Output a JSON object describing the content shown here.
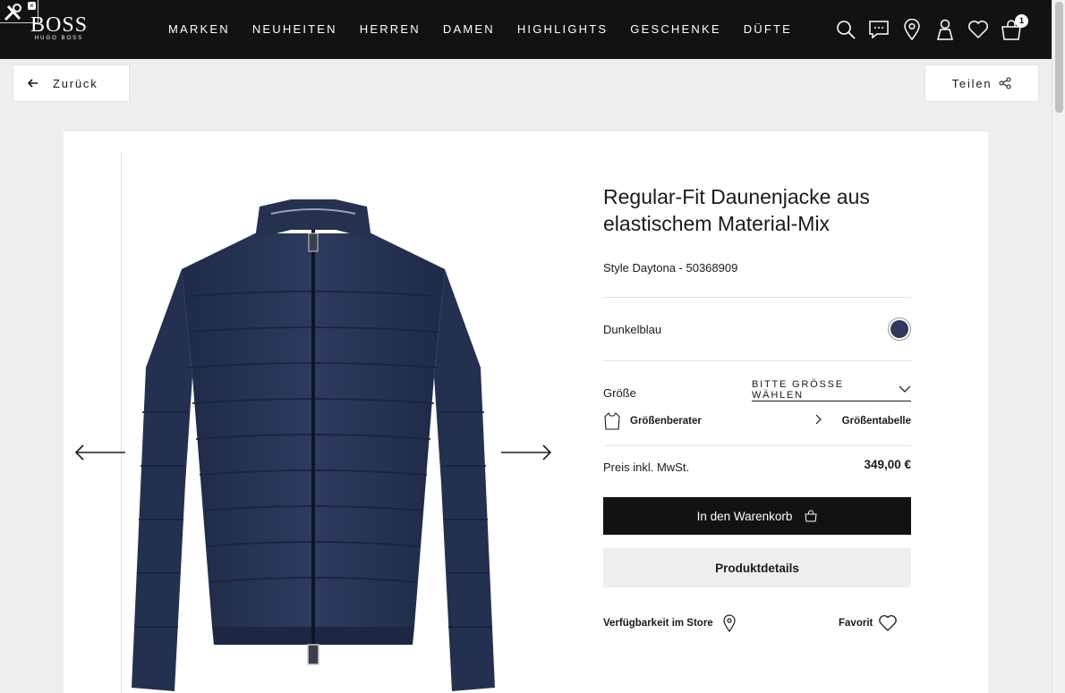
{
  "header": {
    "logo_main": "BOSS",
    "logo_sub": "HUGO BOSS",
    "nav": [
      {
        "label": "MARKEN"
      },
      {
        "label": "NEUHEITEN"
      },
      {
        "label": "HERREN"
      },
      {
        "label": "DAMEN"
      },
      {
        "label": "HIGHLIGHTS"
      },
      {
        "label": "GESCHENKE"
      },
      {
        "label": "DÜFTE"
      }
    ],
    "icons": [
      "search-icon",
      "chat-icon",
      "location-pin-icon",
      "account-icon",
      "wishlist-heart-icon",
      "cart-bag-icon"
    ],
    "cart_count": "1"
  },
  "toolbar": {
    "back_label": "Zurück",
    "share_label": "Teilen"
  },
  "product": {
    "title": "Regular-Fit Daunenjacke aus elastischem Material-Mix",
    "style": "Style Daytona - 50368909",
    "color_name": "Dunkelblau",
    "color_hex": "#2f3a5c",
    "size_label": "Größe",
    "size_select": "BITTE GRÖSSE WÄHLEN",
    "size_advisor": "Größenberater",
    "size_table": "Größentabelle",
    "price_label": "Preis inkl. MwSt.",
    "price": "349,00 €",
    "add_to_cart": "In den Warenkorb",
    "details": "Produktdetails",
    "store_availability": "Verfügbarkeit im Store",
    "favorite": "Favorit"
  }
}
